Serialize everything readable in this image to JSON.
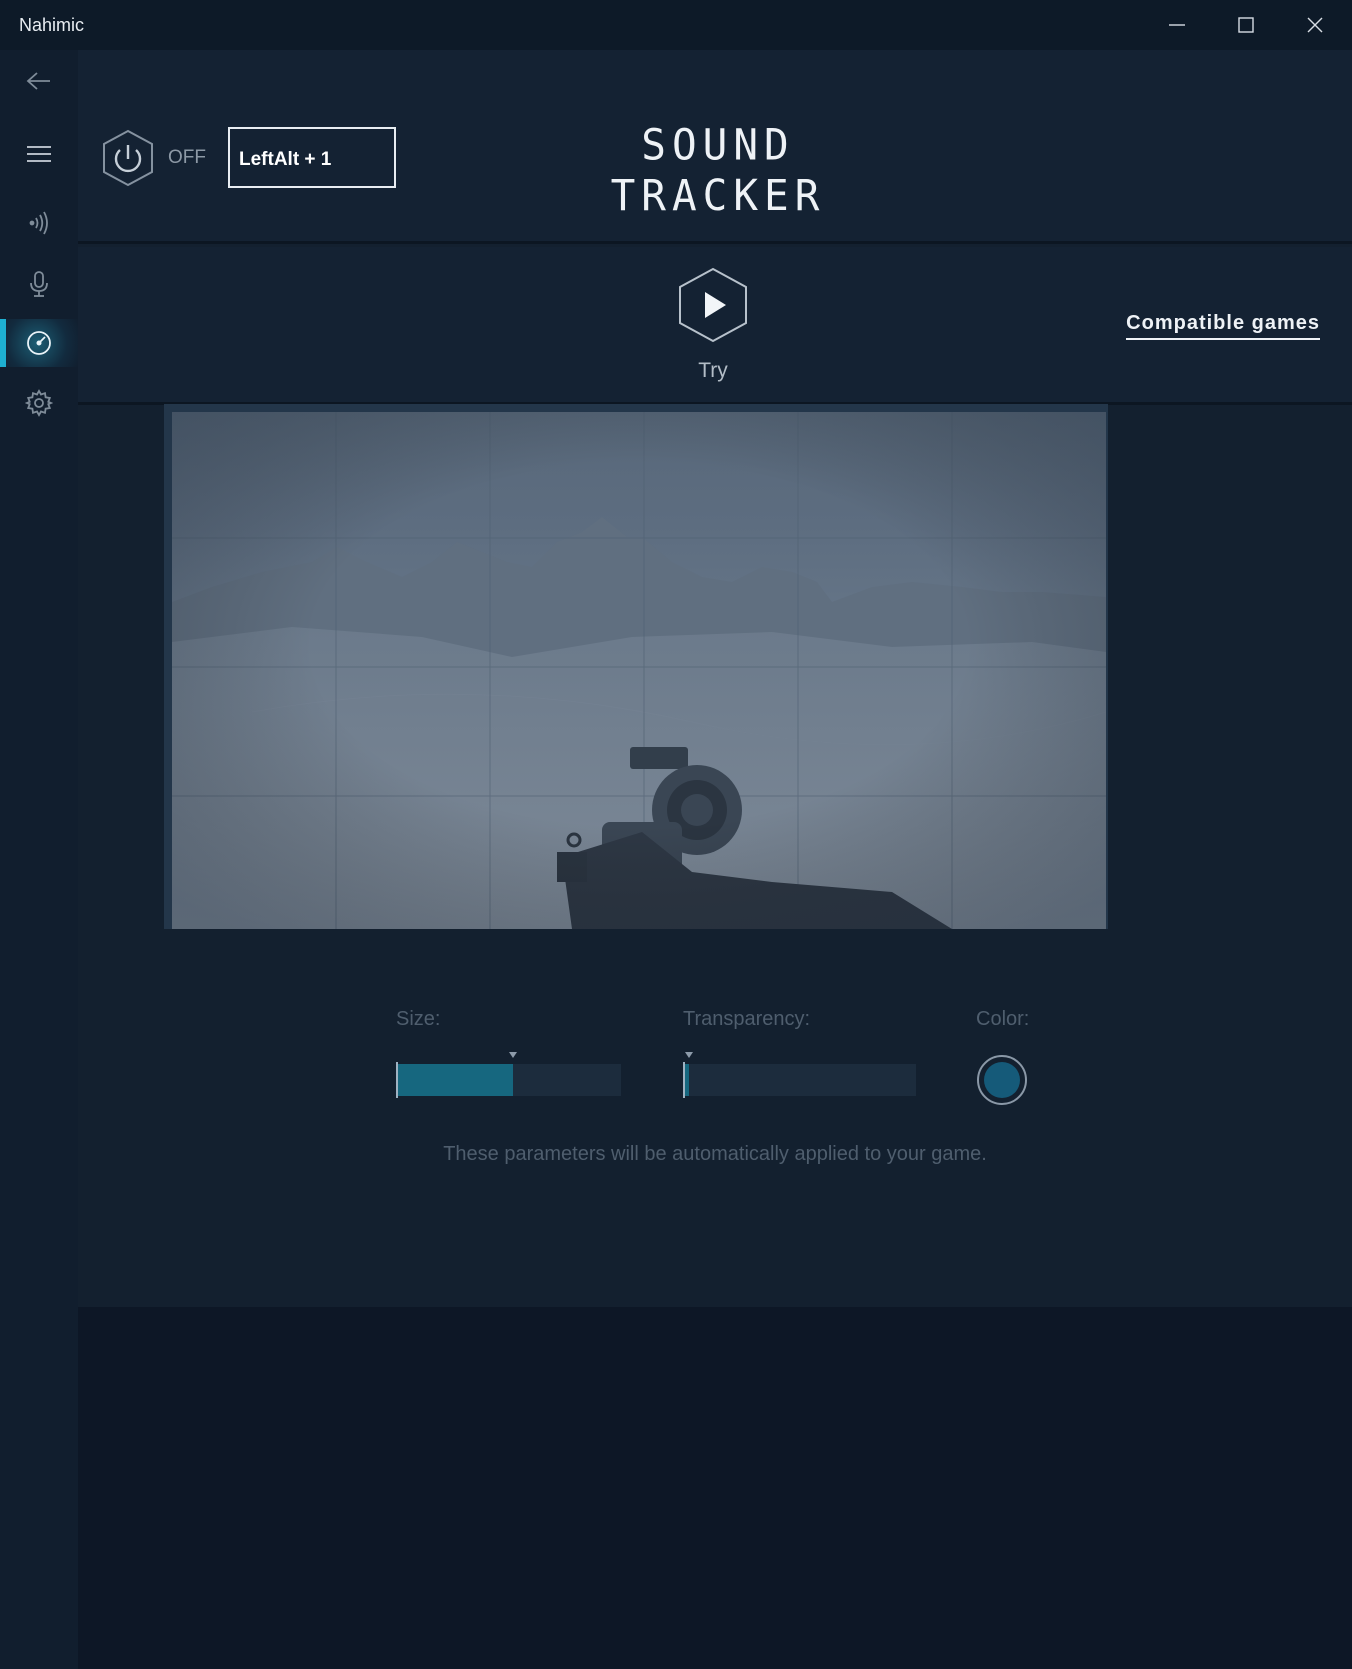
{
  "window": {
    "title": "Nahimic",
    "controls": [
      "minimize-icon",
      "maximize-icon",
      "close-icon"
    ]
  },
  "sidebar": {
    "items": [
      {
        "icon": "back-arrow-icon",
        "active": false
      },
      {
        "icon": "hamburger-menu-icon",
        "active": false
      },
      {
        "icon": "sound-waves-icon",
        "active": false
      },
      {
        "icon": "microphone-icon",
        "active": false
      },
      {
        "icon": "sound-tracker-icon",
        "active": true
      },
      {
        "icon": "gear-icon",
        "active": false
      }
    ],
    "accent": "#1eb0d2"
  },
  "header": {
    "power_state": "OFF",
    "shortcut": "LeftAlt + 1",
    "title": "SOUND TRACKER"
  },
  "try": {
    "label": "Try",
    "compatible_link": "Compatible games"
  },
  "settings": {
    "size_label": "Size:",
    "size_value": 0.52,
    "transparency_label": "Transparency:",
    "transparency_value": 0.02,
    "color_label": "Color:",
    "color_value": "#155a79",
    "hint": "These parameters will be automatically applied to your game."
  }
}
